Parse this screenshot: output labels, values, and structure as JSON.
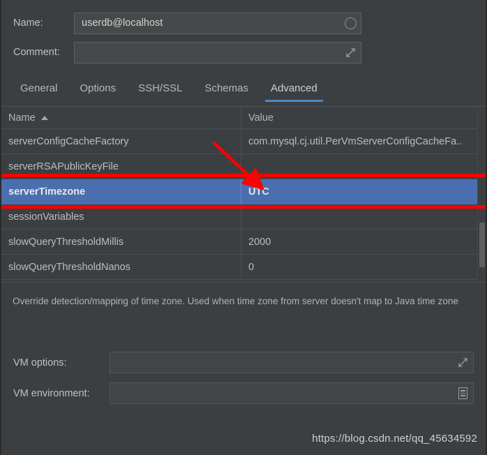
{
  "colors": {
    "window_bg": "#3c3f41",
    "field_bg": "#45494a",
    "selection_blue": "#4b6eaf",
    "tab_underline": "#4a88c7",
    "annotation_red": "#fe0000",
    "text": "#bbbbbb"
  },
  "form": {
    "name_label": "Name:",
    "name_value": "userdb@localhost",
    "name_placeholder": "",
    "name_icon": "circle-icon",
    "comment_label": "Comment:",
    "comment_value": "",
    "comment_placeholder": "",
    "comment_icon": "expand-icon"
  },
  "tabs": [
    {
      "label": "General",
      "active": false
    },
    {
      "label": "Options",
      "active": false
    },
    {
      "label": "SSH/SSL",
      "active": false
    },
    {
      "label": "Schemas",
      "active": false
    },
    {
      "label": "Advanced",
      "active": true
    }
  ],
  "table": {
    "columns": [
      {
        "label": "Name",
        "sort": "ascending",
        "sort_icon": "sort-ascending-icon"
      },
      {
        "label": "Value",
        "sort": "none"
      }
    ],
    "rows": [
      {
        "name": "serverConfigCacheFactory",
        "value": "com.mysql.cj.util.PerVmServerConfigCacheFa..",
        "selected": false
      },
      {
        "name": "serverRSAPublicKeyFile",
        "value": "",
        "selected": false
      },
      {
        "name": "serverTimezone",
        "value": "UTC",
        "selected": true
      },
      {
        "name": "sessionVariables",
        "value": "",
        "selected": false
      },
      {
        "name": "slowQueryThresholdMillis",
        "value": "2000",
        "selected": false
      },
      {
        "name": "slowQueryThresholdNanos",
        "value": "0",
        "selected": false
      }
    ]
  },
  "description": "Override detection/mapping of time zone. Used when time zone from server doesn't map to Java time zone",
  "vm": {
    "options_label": "VM options:",
    "options_value": "",
    "options_icon": "expand-icon",
    "environment_label": "VM environment:",
    "environment_value": "",
    "environment_icon": "document-list-icon"
  },
  "annotations": {
    "arrow_color": "#fe0000",
    "line_color": "#fe0000",
    "highlighted_row": "serverTimezone"
  },
  "watermark": "https://blog.csdn.net/qq_45634592"
}
